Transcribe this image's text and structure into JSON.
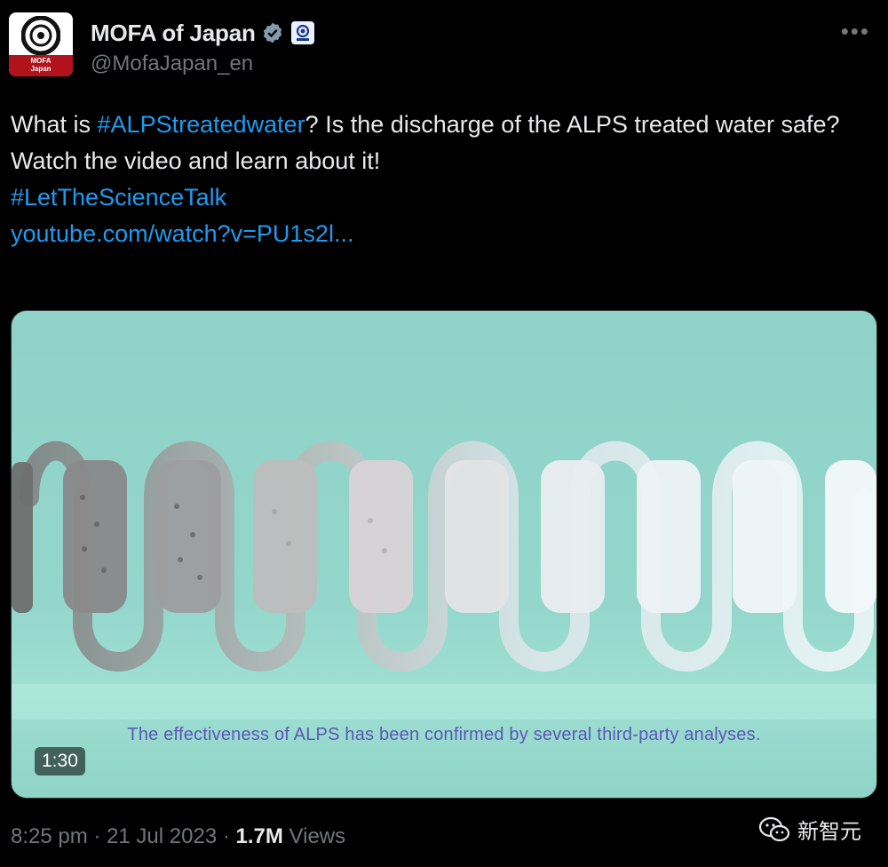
{
  "account": {
    "display_name": "MOFA of Japan",
    "handle": "@MofaJapan_en",
    "avatar_line1": "MOFA",
    "avatar_line2": "Japan"
  },
  "tweet": {
    "text_1": "What is ",
    "hashtag_1": "#ALPStreatedwater",
    "text_2": "? Is the discharge of the ALPS treated water safe?",
    "line_2": "Watch the video and learn about it!",
    "hashtag_2": "#LetTheScienceTalk",
    "link": "youtube.com/watch?v=PU1s2l..."
  },
  "media": {
    "caption": "The effectiveness of ALPS has been confirmed by several third-party analyses.",
    "duration": "1:30"
  },
  "meta": {
    "time": "8:25 pm",
    "separator": "·",
    "date": "21 Jul 2023",
    "views_count": "1.7M",
    "views_label": "Views"
  },
  "watermark": {
    "label": "新智元"
  },
  "colors": {
    "background": "#000000",
    "text": "#e7e9ea",
    "secondary": "#71767b",
    "link": "#1d9bf0",
    "verified": "#829aab",
    "video_bg": "#93d6cb",
    "caption": "#5c55b8"
  },
  "icons": {
    "verified": "verified-badge-icon",
    "affiliation": "government-affiliation-icon",
    "more": "more-options-icon",
    "watermark": "wechat-icon"
  }
}
